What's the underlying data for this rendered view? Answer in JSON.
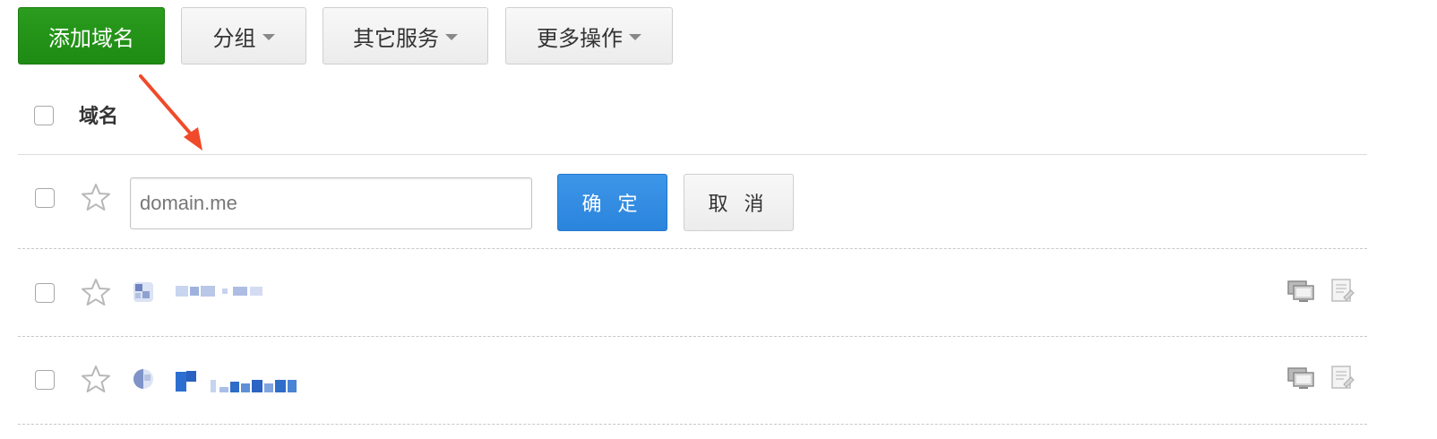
{
  "toolbar": {
    "add_domain": "添加域名",
    "group": "分组",
    "other_services": "其它服务",
    "more_actions": "更多操作"
  },
  "table": {
    "header": {
      "domain_col": "域名"
    },
    "new_row": {
      "input_value": "",
      "input_placeholder": "domain.me",
      "confirm": "确 定",
      "cancel": "取 消"
    },
    "rows": [
      {
        "domain_hidden": true,
        "starred": false,
        "icons": [
          "monitor-icon",
          "record-icon"
        ]
      },
      {
        "domain_hidden": true,
        "starred": false,
        "icons": [
          "monitor-icon",
          "record-icon"
        ]
      }
    ]
  },
  "colors": {
    "primary_green": "#1e8a13",
    "confirm_blue": "#2b84dc",
    "annotation_arrow": "#f04a2a"
  }
}
